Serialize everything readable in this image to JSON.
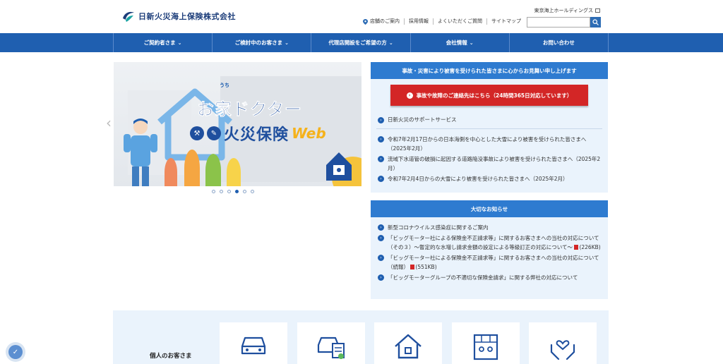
{
  "header": {
    "company_name": "日新火災海上保険株式会社",
    "holdings_link": "東京海上ホールディングス",
    "util_nav": [
      "店舗のご案内",
      "採用情報",
      "よくいただくご質問",
      "サイトマップ"
    ],
    "search_placeholder": ""
  },
  "gnav": {
    "items": [
      {
        "label": "ご契約者さま",
        "has_chevron": true
      },
      {
        "label": "ご検討中のお客さま",
        "has_chevron": true
      },
      {
        "label": "代理店開設をご希望の方",
        "has_chevron": true
      },
      {
        "label": "会社情報",
        "has_chevron": true
      },
      {
        "label": "お問い合わせ",
        "has_chevron": false
      }
    ]
  },
  "hero": {
    "ruby": "うち",
    "title_line1": "お家ドクター",
    "title_line2": "火災保険",
    "title_web": "Web",
    "slide_count": 6,
    "active_slide": 4
  },
  "accident": {
    "heading": "事故・災害により被害を受けられた皆さまに心からお見舞い申し上げます",
    "contact_button": "事故や故障のご連絡先はこちら（24時間365日対応しています）",
    "support_link": "日新火災のサポートサービス",
    "links": [
      "令和7年2月17日からの日本海側を中心とした大雪により被害を受けられた皆さまへ（2025年2月）",
      "流域下水道管の破損に起因する道路陥没事故により被害を受けられた皆さまへ（2025年2月）",
      "令和7年2月4日からの大雪により被害を受けられた皆さまへ（2025年2月）"
    ]
  },
  "notice": {
    "heading": "大切なお知らせ",
    "items": [
      {
        "text": "新型コロナウイルス感染症に関するご案内",
        "pdf": ""
      },
      {
        "text": "「ビッグモーター社による保険金不正請求等」に関するお客さまへの当社の対応について（その３）～暫定的な水増し請求金額の設定による等級訂正の対応について～",
        "pdf": "(226KB)"
      },
      {
        "text": "「ビッグモーター社による保険金不正請求等」に関するお客さまへの当社の対応について（続報）",
        "pdf": "(551KB)"
      },
      {
        "text": "「ビッグモーターグループの不適切な保険金請求」に関する弊社の対応について",
        "pdf": ""
      }
    ]
  },
  "bottom": {
    "title": "個人のお客さま",
    "cards": [
      "car-icon",
      "car-document-icon",
      "house-icon",
      "building-people-icon",
      "hands-heart-icon"
    ]
  },
  "colors": {
    "primary": "#1f5fb0",
    "panel_head": "#2e7bd0",
    "panel_bg": "#eaf3fc",
    "alert_red": "#d32626"
  }
}
